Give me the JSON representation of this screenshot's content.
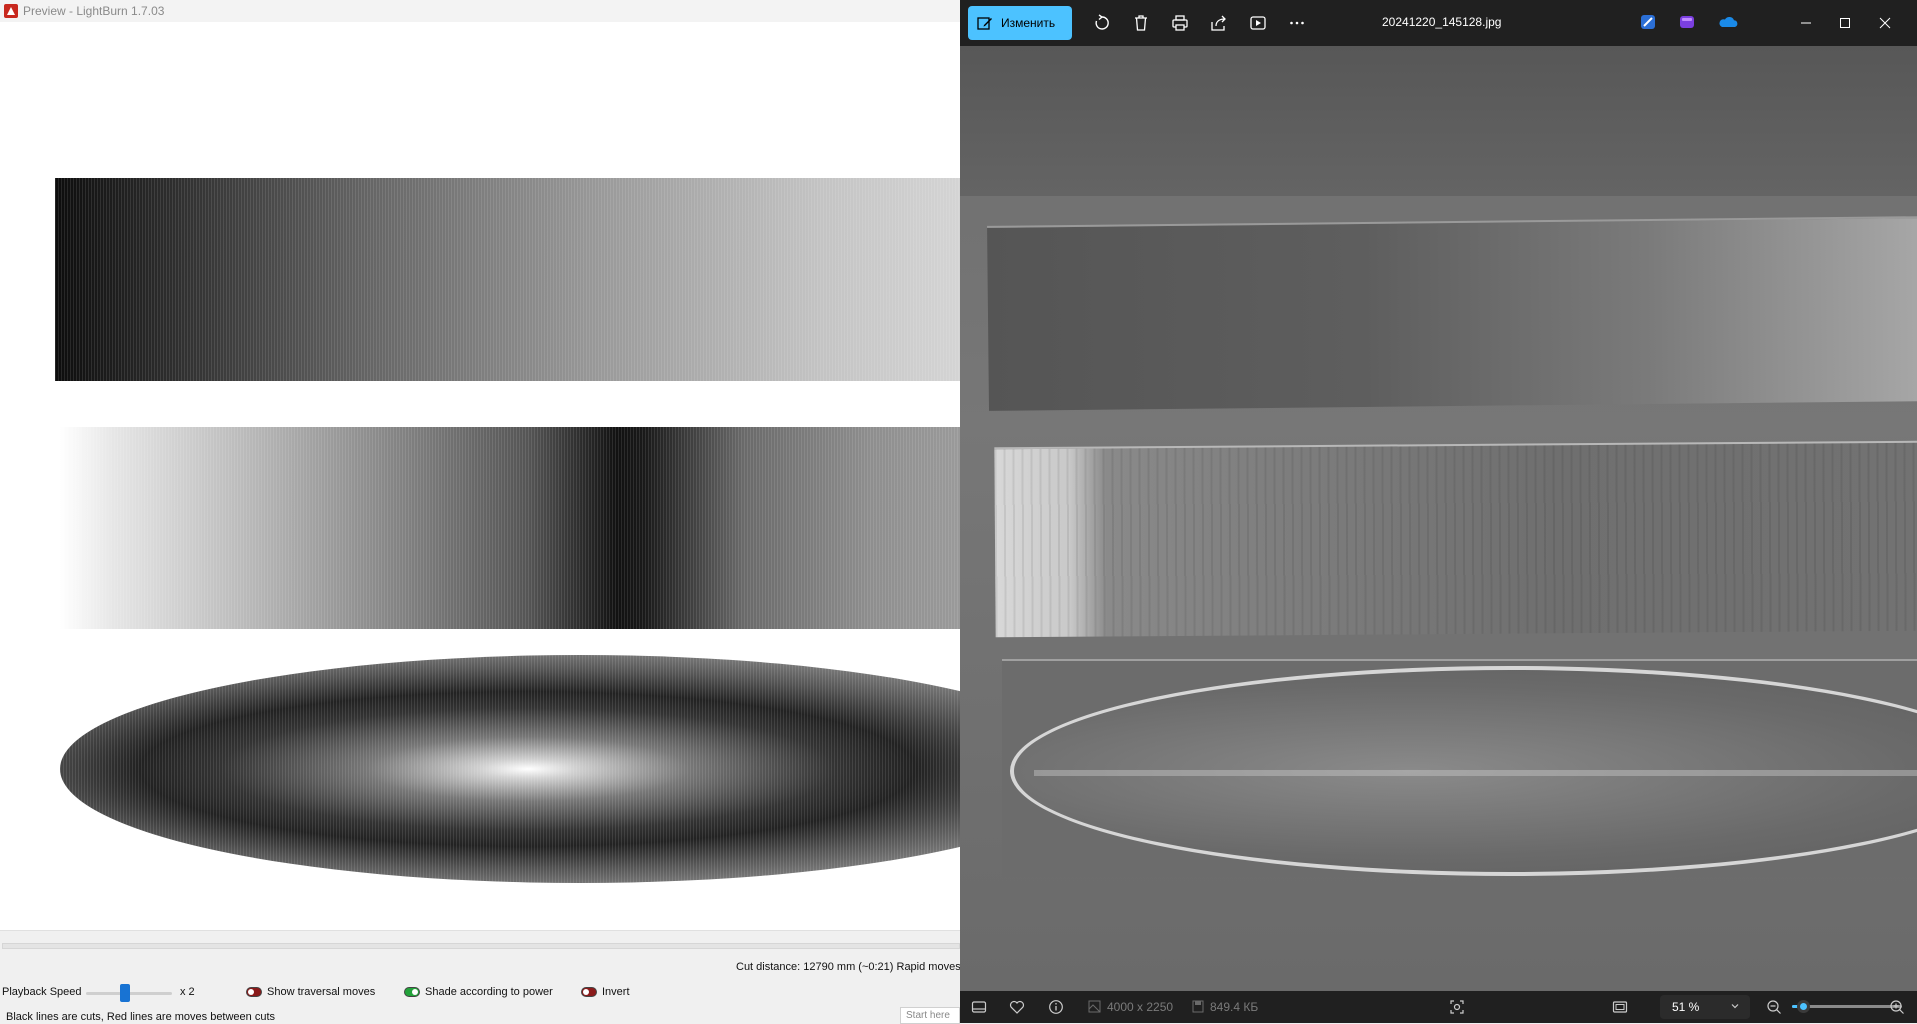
{
  "lightburn": {
    "title": "Preview - LightBurn 1.7.03",
    "cut_distance": "Cut distance: 12790 mm (~0:21)   Rapid moves",
    "playback_label": "Playback Speed",
    "playback_speed": "x 2",
    "playback_slider_fraction": 0.45,
    "toggles": [
      {
        "label": "Show traversal moves",
        "state": "off"
      },
      {
        "label": "Shade according to power",
        "state": "on"
      },
      {
        "label": "Invert",
        "state": "off"
      }
    ],
    "legend": "Black lines are cuts, Red lines are moves between cuts",
    "start_here": "Start here"
  },
  "photos": {
    "edit_label": "Изменить",
    "file_name": "20241220_145128.jpg",
    "dimensions": "4000 x 2250",
    "file_size": "849.4 КБ",
    "zoom": "51 %",
    "zoom_fraction": 0.1,
    "toolbar_icons": [
      "rotate-icon",
      "delete-icon",
      "print-icon",
      "share-icon",
      "slideshow-icon",
      "more-icon"
    ],
    "app_icons": [
      "clipchamp-icon",
      "designer-icon",
      "onedrive-icon"
    ],
    "accent_color": "#4cc2ff"
  }
}
